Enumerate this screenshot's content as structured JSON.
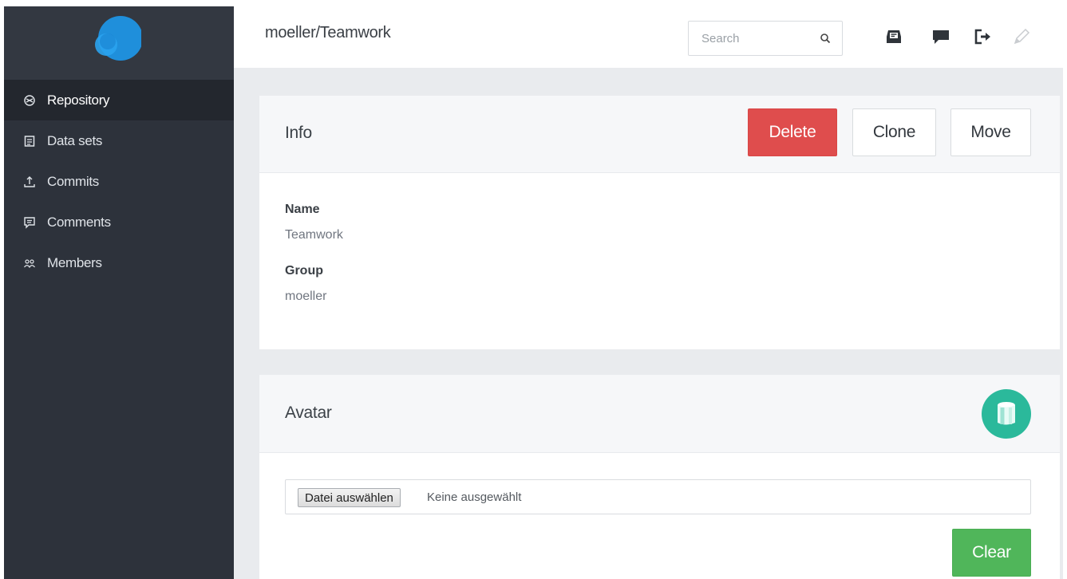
{
  "breadcrumb": "moeller/Teamwork",
  "search": {
    "placeholder": "Search"
  },
  "sidebar": {
    "items": [
      {
        "label": "Repository",
        "icon": "repository-icon",
        "active": true
      },
      {
        "label": "Data sets",
        "icon": "dataset-icon",
        "active": false
      },
      {
        "label": "Commits",
        "icon": "commit-icon",
        "active": false
      },
      {
        "label": "Comments",
        "icon": "comment-icon",
        "active": false
      },
      {
        "label": "Members",
        "icon": "members-icon",
        "active": false
      }
    ]
  },
  "topbar_icons": [
    "inbox-icon",
    "chat-icon",
    "logout-icon",
    "pencil-icon"
  ],
  "info": {
    "title": "Info",
    "delete_label": "Delete",
    "clone_label": "Clone",
    "move_label": "Move",
    "name_label": "Name",
    "name_value": "Teamwork",
    "group_label": "Group",
    "group_value": "moeller"
  },
  "avatar": {
    "title": "Avatar",
    "file_button": "Datei auswählen",
    "file_status": "Keine ausgewählt",
    "clear_label": "Clear",
    "badge_icon": "cylinder-icon"
  },
  "colors": {
    "sidebar_bg": "#2d323b",
    "sidebar_active": "#23272e",
    "danger": "#df4d4d",
    "success": "#50b65a",
    "teal": "#2bb99b",
    "logo_blue": "#1e8fdc"
  }
}
